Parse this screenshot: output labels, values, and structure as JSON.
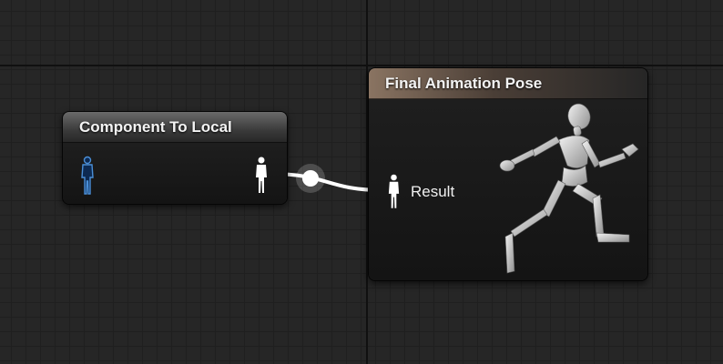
{
  "graph": {
    "nodes": {
      "component_to_local": {
        "title": "Component To Local",
        "input_pin_icon": "pose-pin-icon",
        "output_pin_icon": "pose-pin-icon"
      },
      "final_animation_pose": {
        "title": "Final Animation Pose",
        "result_label": "Result",
        "result_pin_icon": "pose-pin-icon",
        "preview_icon": "running-mannequin-icon"
      }
    },
    "colors": {
      "input_pin": "#4a8fd8",
      "output_pin": "#ffffff",
      "wire": "#ffffff",
      "final_header_accent": "#8a7462"
    }
  }
}
